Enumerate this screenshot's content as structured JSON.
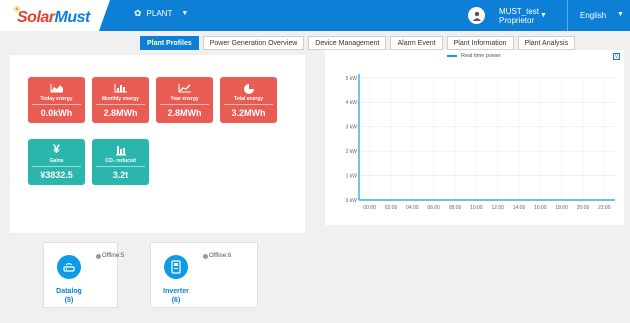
{
  "header": {
    "logo_prefix": "Solar",
    "logo_suffix": "Must",
    "plant_label": "PLANT",
    "user_line1": "MUST_test",
    "user_line2": "Proprietor",
    "language": "English",
    "colors": {
      "bar": "#0d7fd6",
      "logo_red": "#e8412c"
    }
  },
  "tabs": [
    {
      "label": "Plant Profiles",
      "active": true
    },
    {
      "label": "Power Generation Overview",
      "active": false
    },
    {
      "label": "Device Management",
      "active": false
    },
    {
      "label": "Alarm Event",
      "active": false
    },
    {
      "label": "Plant Information",
      "active": false
    },
    {
      "label": "Plant Analysis",
      "active": false
    }
  ],
  "stats": [
    {
      "label": "Today energy",
      "value": "0.0kWh",
      "icon": "area-chart-icon",
      "color": "#e85c53"
    },
    {
      "label": "Monthly energy",
      "value": "2.8MWh",
      "icon": "bar-chart-icon",
      "color": "#e85c53"
    },
    {
      "label": "Year energy",
      "value": "2.8MWh",
      "icon": "line-chart-icon",
      "color": "#e85c53"
    },
    {
      "label": "Total energy",
      "value": "3.2MWh",
      "icon": "pie-chart-icon",
      "color": "#e85c53"
    },
    {
      "label": "Gains",
      "value": "¥3832.5",
      "icon": "yen-icon",
      "color": "#2ab5ad"
    },
    {
      "label": "CO₂ reduced",
      "value": "3.2t",
      "icon": "factory-icon",
      "color": "#2ab5ad"
    }
  ],
  "chart_data": {
    "type": "line",
    "series": [
      {
        "name": "Real time power",
        "values": [
          0,
          0,
          0,
          0,
          0,
          0,
          0,
          0,
          0,
          0,
          0,
          0
        ]
      }
    ],
    "x": [
      "00:00",
      "02:00",
      "04:00",
      "06:00",
      "08:00",
      "10:00",
      "12:00",
      "14:00",
      "16:00",
      "18:00",
      "20:00",
      "22:00"
    ],
    "yticks": [
      "0 kW",
      "1 kW",
      "2 kW",
      "3 kW",
      "4 kW",
      "5 kW"
    ],
    "ylim": [
      0,
      5
    ],
    "grid": true,
    "legend": "top-center",
    "line_color": "#0aa0e0",
    "export_label": "V"
  },
  "devices": [
    {
      "name": "Datalog",
      "count": "(5)",
      "status": "Offline:5",
      "icon": "datalogger-icon"
    },
    {
      "name": "Inverter",
      "count": "(6)",
      "status": "Offline:6",
      "icon": "inverter-icon"
    }
  ]
}
